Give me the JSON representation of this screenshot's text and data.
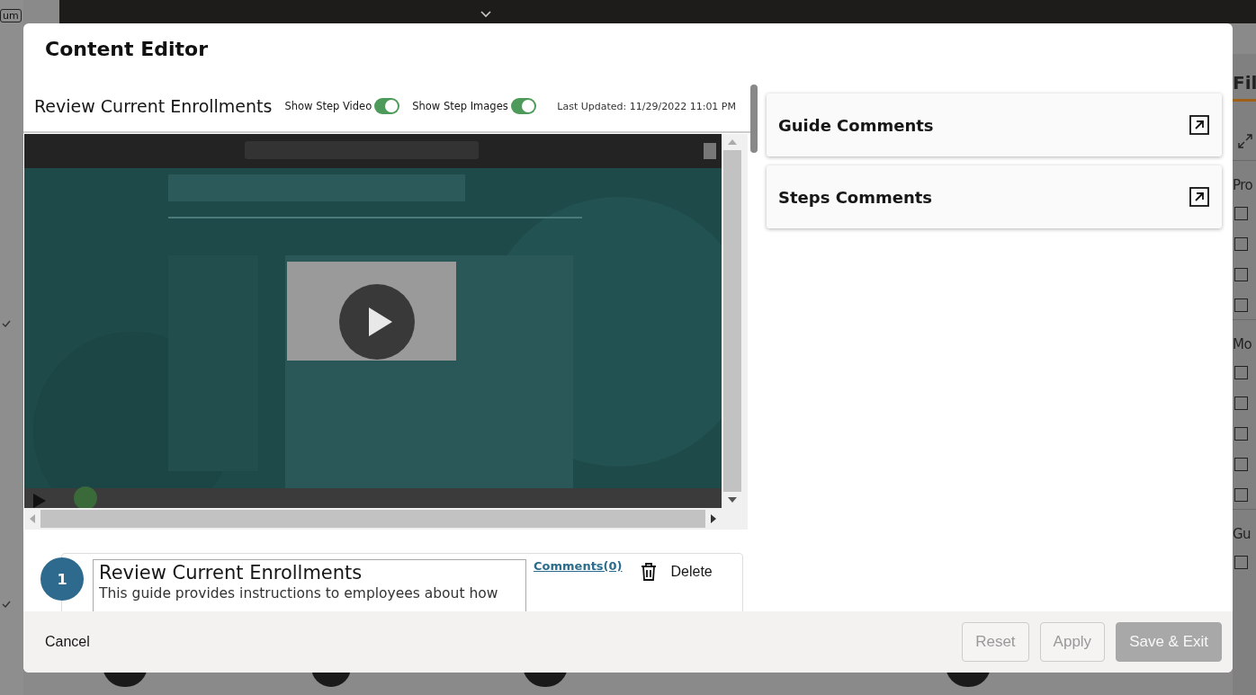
{
  "backdrop": {
    "left_badge": "um",
    "right_tab": "Fil",
    "right_sections": [
      {
        "heading": "Pro",
        "checkboxes": [
          {
            "checked": false
          },
          {
            "checked": false
          },
          {
            "checked": false
          },
          {
            "checked": false
          }
        ]
      },
      {
        "heading": "Mo",
        "checkboxes": [
          {
            "checked": false
          },
          {
            "checked": false
          },
          {
            "checked": false
          },
          {
            "checked": false
          },
          {
            "checked": false
          }
        ]
      },
      {
        "heading": "Gu",
        "checkboxes": [
          {
            "checked": false
          }
        ]
      }
    ]
  },
  "dialog": {
    "title": "Content Editor",
    "guide": {
      "title": "Review Current Enrollments",
      "toggles": [
        {
          "label": "Show Step Video",
          "on": true
        },
        {
          "label": "Show Step Images",
          "on": true
        }
      ],
      "last_updated": "Last Updated: 11/29/2022 11:01 PM"
    },
    "steps": [
      {
        "number": "1",
        "title": "Review Current Enrollments",
        "description": "This guide provides instructions to employees about how",
        "comments_link": "Comments(0)",
        "delete_label": "Delete"
      }
    ],
    "panels": [
      {
        "title": "Guide Comments"
      },
      {
        "title": "Steps Comments"
      }
    ],
    "footer": {
      "cancel": "Cancel",
      "buttons": [
        {
          "label": "Reset",
          "disabled": true,
          "kind": "outline"
        },
        {
          "label": "Apply",
          "disabled": true,
          "kind": "outline"
        },
        {
          "label": "Save & Exit",
          "disabled": true,
          "kind": "primary"
        }
      ]
    }
  }
}
